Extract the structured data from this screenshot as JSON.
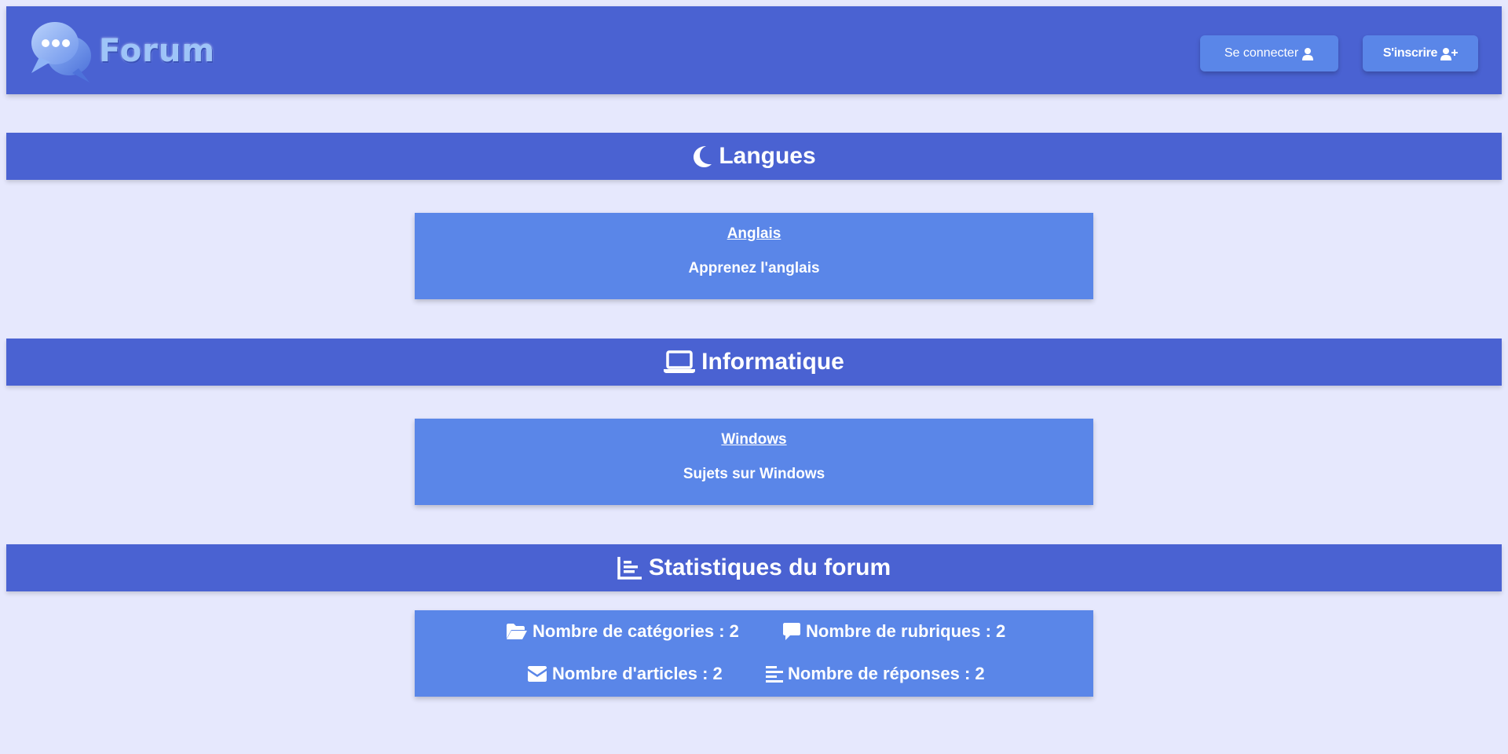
{
  "header": {
    "logo_text": "Forum",
    "login_label": "Se connecter",
    "signup_label": "S'inscrire"
  },
  "sections": {
    "langues": {
      "title": "Langues",
      "icon": "moon-icon",
      "card": {
        "title": "Anglais",
        "description": "Apprenez l'anglais"
      }
    },
    "informatique": {
      "title": "Informatique",
      "icon": "laptop-icon",
      "card": {
        "title": "Windows",
        "description": "Sujets sur Windows"
      }
    },
    "stats": {
      "title": "Statistiques du forum",
      "icon": "chart-icon",
      "categories": "Nombre de catégories : 2",
      "rubriques": "Nombre de rubriques : 2",
      "articles": "Nombre d'articles : 2",
      "reponses": "Nombre de réponses : 2"
    }
  },
  "colors": {
    "background": "#e6e8fd",
    "primary": "#4a62d2",
    "card": "#5a86e8",
    "logo_text": "#9ec4f8"
  }
}
